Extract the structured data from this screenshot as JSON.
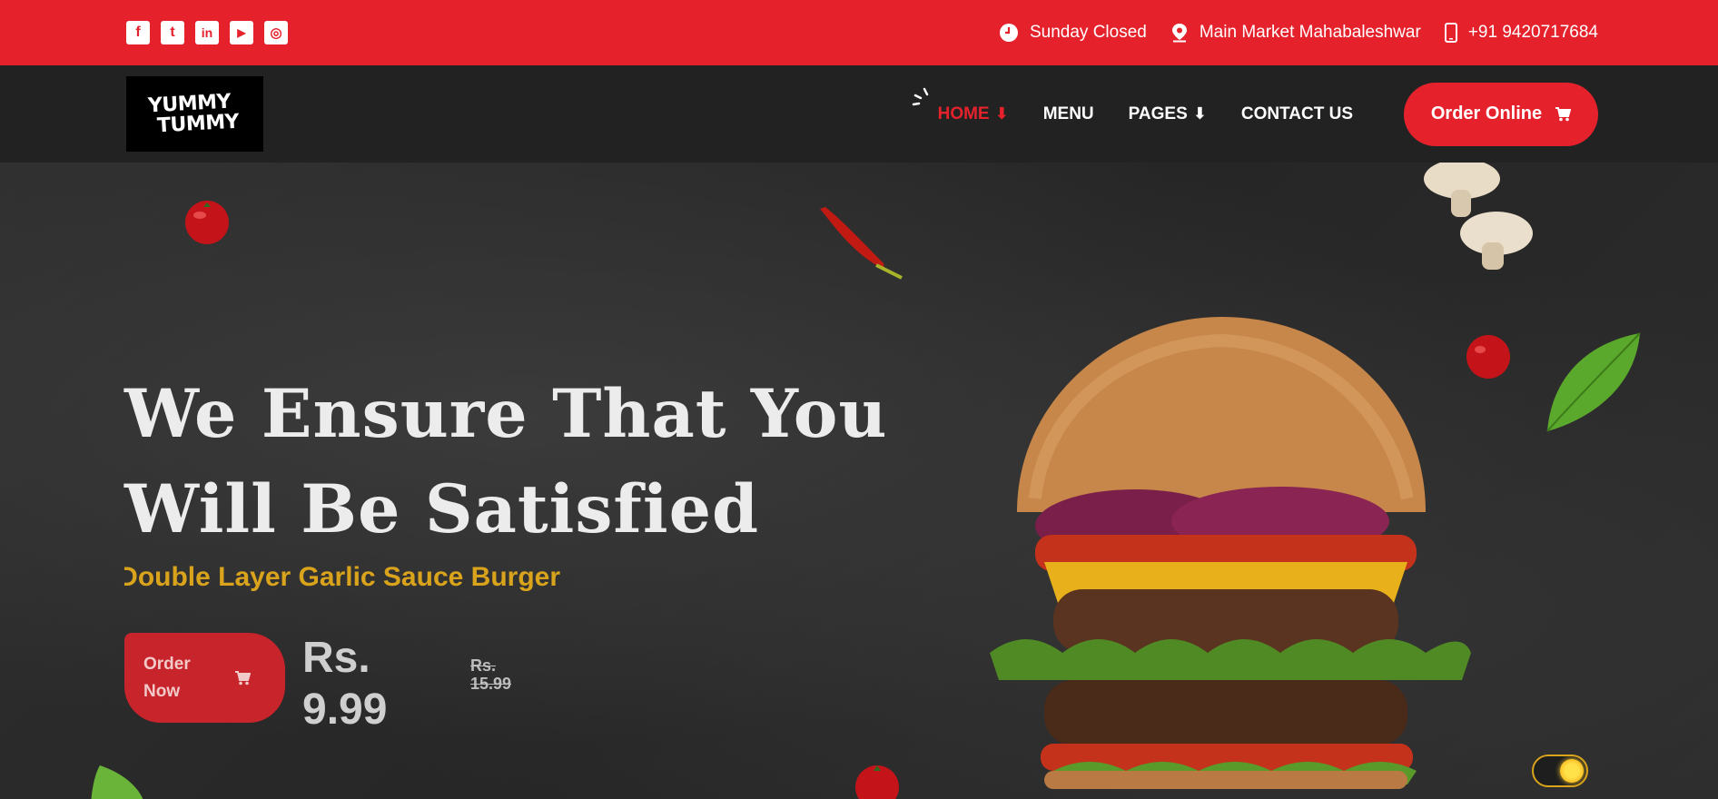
{
  "topbar": {
    "social": [
      {
        "icon": "facebook-icon",
        "glyph": "f"
      },
      {
        "icon": "twitter-icon",
        "glyph": "t"
      },
      {
        "icon": "linkedin-icon",
        "glyph": "in"
      },
      {
        "icon": "youtube-icon",
        "glyph": "▶"
      },
      {
        "icon": "instagram-icon",
        "glyph": "◎"
      }
    ],
    "hours": "Sunday Closed",
    "address": "Main Market Mahabaleshwar",
    "phone": "+91 9420717684"
  },
  "nav": {
    "logo_line1": "YUMMY",
    "logo_line2": "TUMMY",
    "items": [
      {
        "label": "HOME",
        "arrow": "⬇",
        "active": true
      },
      {
        "label": "MENU",
        "arrow": "",
        "active": false
      },
      {
        "label": "PAGES",
        "arrow": "⬇",
        "active": false
      },
      {
        "label": "CONTACT US",
        "arrow": "",
        "active": false
      }
    ],
    "order_online": "Order Online"
  },
  "hero": {
    "title_line1": "We Ensure That You",
    "title_line2": "Will Be Satisfied",
    "subtitle": "Double Layer Garlic Sauce Burger",
    "order_now": "Order Now",
    "price": "Rs. 9.99",
    "old_price": "Rs. 15.99"
  },
  "colors": {
    "accent": "#e5222c",
    "nav_bg": "#222222",
    "subtitle": "#d9a31b"
  }
}
